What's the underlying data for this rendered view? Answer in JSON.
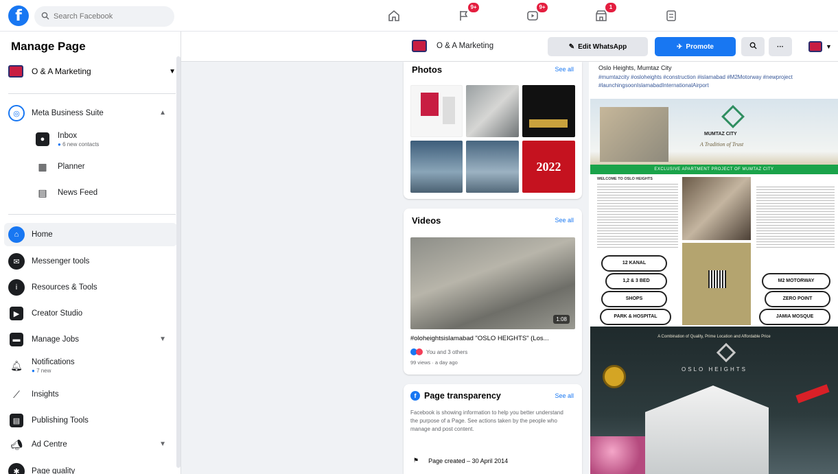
{
  "topbar": {
    "search_placeholder": "Search Facebook",
    "badges": {
      "flag": "9+",
      "video": "9+",
      "marketplace": "1"
    }
  },
  "sidebar": {
    "title": "Manage Page",
    "page_name": "O & A Marketing",
    "business_suite": "Meta Business Suite",
    "sub_items": [
      {
        "label": "Inbox",
        "sub": "6 new contacts"
      },
      {
        "label": "Planner"
      },
      {
        "label": "News Feed"
      }
    ],
    "items": [
      {
        "label": "Home"
      },
      {
        "label": "Messenger tools"
      },
      {
        "label": "Resources & Tools"
      },
      {
        "label": "Creator Studio"
      },
      {
        "label": "Manage Jobs"
      },
      {
        "label": "Notifications",
        "sub": "7 new"
      },
      {
        "label": "Insights"
      },
      {
        "label": "Publishing Tools"
      },
      {
        "label": "Ad Centre"
      },
      {
        "label": "Page quality"
      }
    ]
  },
  "pagebar": {
    "page_name": "O & A Marketing",
    "edit_whatsapp": "Edit WhatsApp",
    "promote": "Promote",
    "more": "···"
  },
  "photos": {
    "title": "Photos",
    "see_all": "See all",
    "year_label": "2022"
  },
  "videos": {
    "title": "Videos",
    "see_all": "See all",
    "duration": "1:08",
    "caption": "#oloheightsislamabad \"OSLO HEIGHTS\" (Los...",
    "reactions": "You and 3 others",
    "meta": "99 views · a day ago"
  },
  "transparency": {
    "title": "Page transparency",
    "see_all": "See all",
    "body": "Facebook is showing information to help you better understand the purpose of a Page. See actions taken by the people who manage and post content.",
    "created": "Page created – 30 April 2014"
  },
  "post": {
    "location": "Oslo Heights, Mumtaz City",
    "tags": "#mumtazcity #osloheights #construction #islamabad #M2Motorway #newproject #launchingsoonIslamabadInternationalAirport",
    "brand": "MUMTAZ CITY",
    "brand_tagline": "A Tradition of Trust",
    "banner": "EXCLUSIVE APARTMENT PROJECT OF MUMTAZ CITY",
    "welcome": "WELCOME TO OSLO HEIGHTS",
    "feature_left": [
      "12 KANAL",
      "1,2 & 3 BED",
      "SHOPS",
      "PARK & HOSPITAL"
    ],
    "feature_right": [
      "M2 MOTORWAY",
      "ZERO POINT",
      "JAMIA MOSQUE"
    ],
    "combination": "A Combination of Quality, Prime Location and Affordable Price",
    "oslo_heights": "OSLO HEIGHTS"
  }
}
